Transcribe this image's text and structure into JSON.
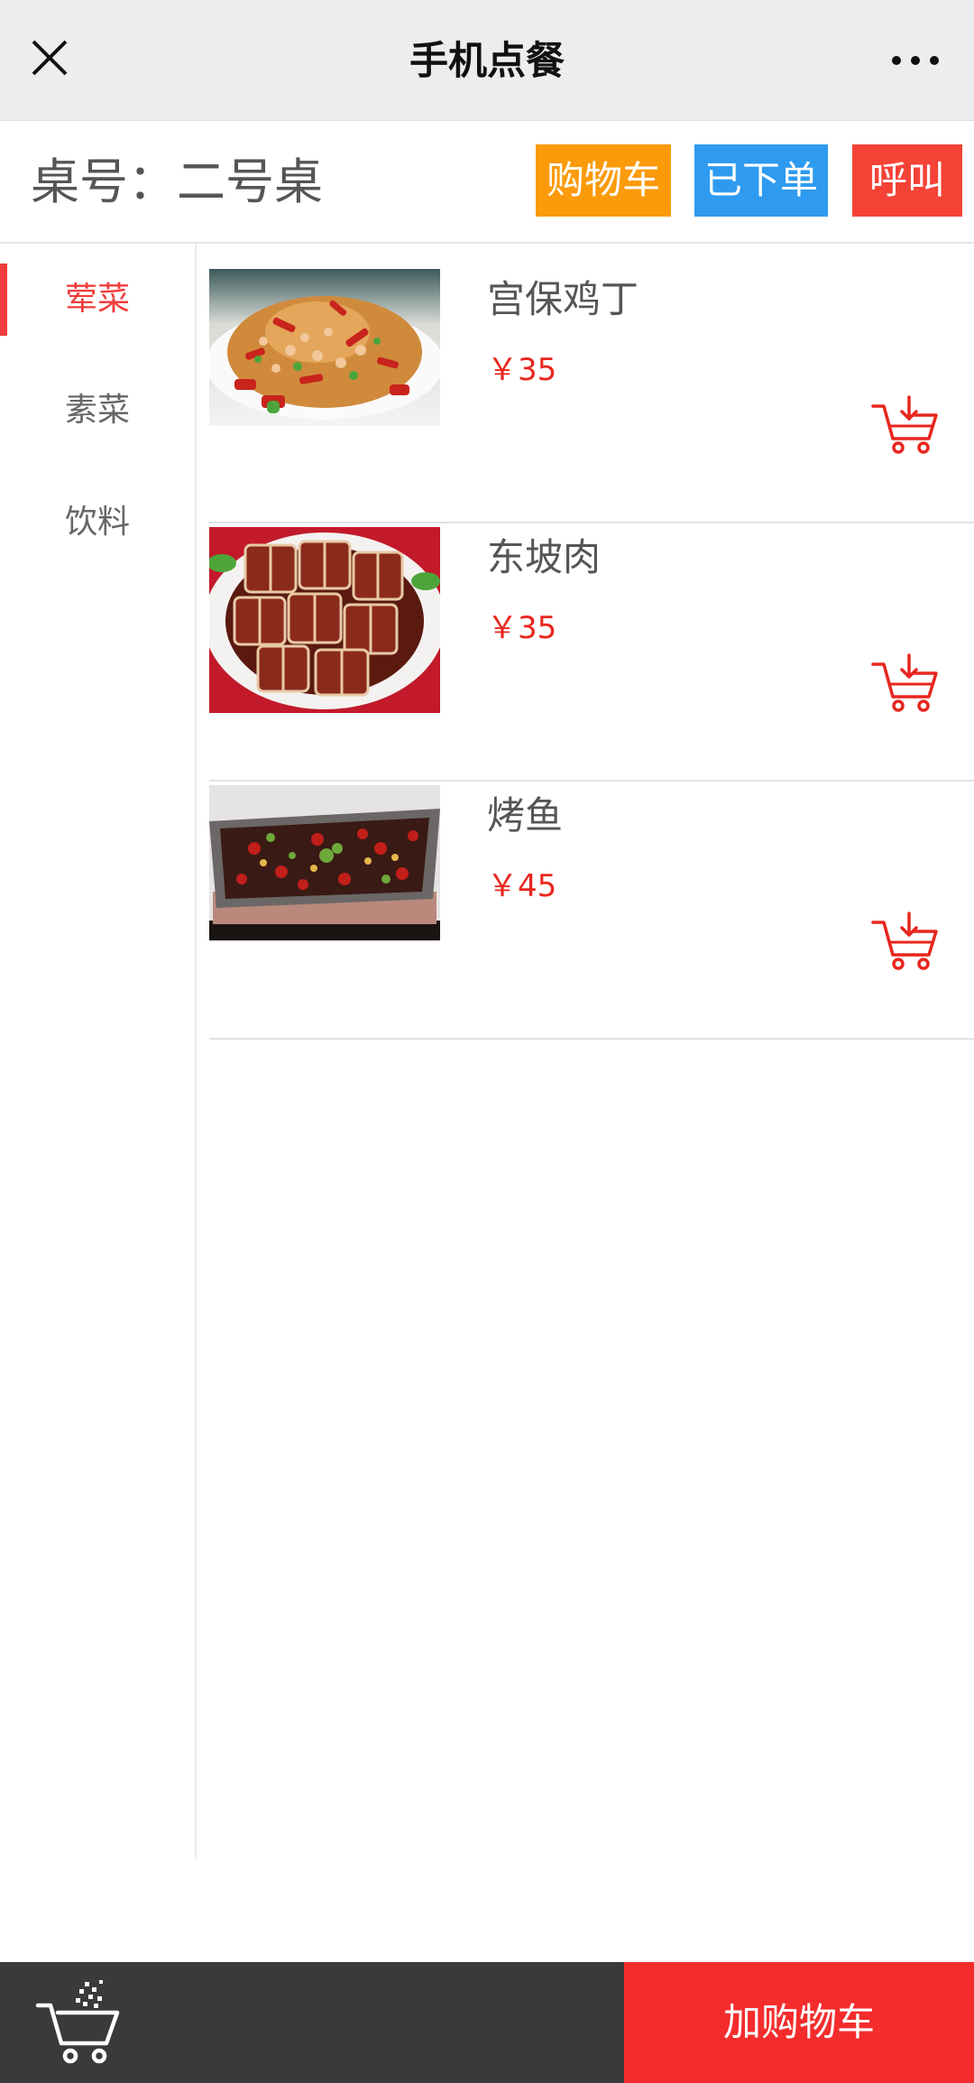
{
  "navbar": {
    "title": "手机点餐"
  },
  "header": {
    "table_label": "桌号：二号桌",
    "cart_label": "购物车",
    "ordered_label": "已下单",
    "call_label": "呼叫"
  },
  "categories": [
    {
      "label": "荤菜",
      "active": true
    },
    {
      "label": "素菜",
      "active": false
    },
    {
      "label": "饮料",
      "active": false
    }
  ],
  "dishes": [
    {
      "name": "宫保鸡丁",
      "price": "￥35"
    },
    {
      "name": "东坡肉",
      "price": "￥35"
    },
    {
      "name": "烤鱼",
      "price": "￥45"
    }
  ],
  "bottom": {
    "add_to_cart_label": "加购物车"
  },
  "colors": {
    "accent_red": "#f03c3c",
    "cart_orange": "#fb9a0a",
    "ordered_blue": "#2e9bf0",
    "bottom_dark": "#3a3a3a"
  },
  "icons": [
    "close-icon",
    "more-icon",
    "add-to-cart-icon",
    "shopping-cart-icon"
  ]
}
